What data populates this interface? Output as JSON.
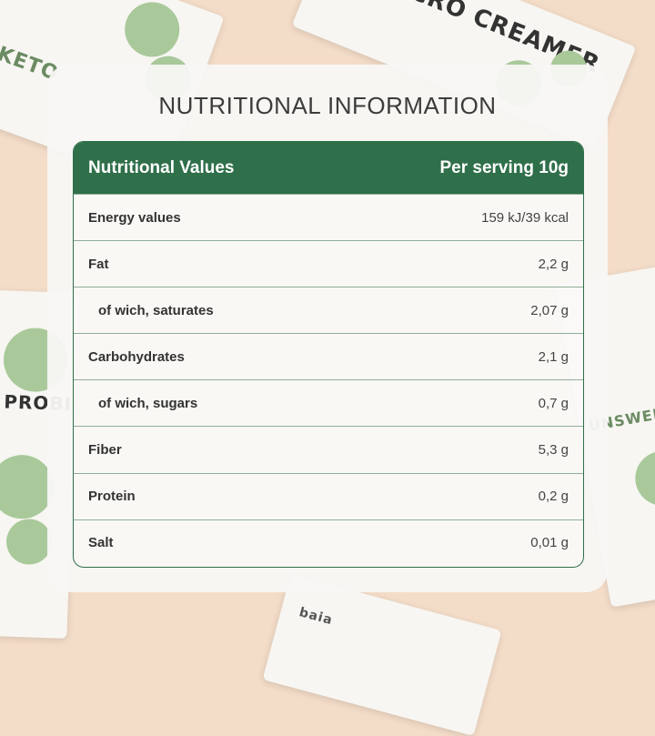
{
  "title": "NUTRITIONAL INFORMATION",
  "colors": {
    "header_bg": "#2f6f4a",
    "background": "#f3dcc8",
    "card": "#f8f7f4"
  },
  "table": {
    "header": {
      "col1": "Nutritional Values",
      "col2": "Per serving 10g"
    },
    "rows": [
      {
        "label": "Energy values",
        "value": "159 kJ/39 kcal"
      },
      {
        "label": "Fat",
        "value": "2,2 g"
      },
      {
        "label": "of wich, saturates",
        "value": "2,07 g"
      },
      {
        "label": "Carbohydrates",
        "value": "2,1 g"
      },
      {
        "label": "of wich, sugars",
        "value": "0,7 g"
      },
      {
        "label": "Fiber",
        "value": "5,3 g"
      },
      {
        "label": "Protein",
        "value": "0,2 g"
      },
      {
        "label": "Salt",
        "value": "0,01 g"
      }
    ]
  },
  "background_packets": {
    "p1": "KETO",
    "p2": "MICRO CREAMER",
    "p3": "PROBIOTIC",
    "p4": "UNSWEETENED",
    "p5": "baia"
  }
}
